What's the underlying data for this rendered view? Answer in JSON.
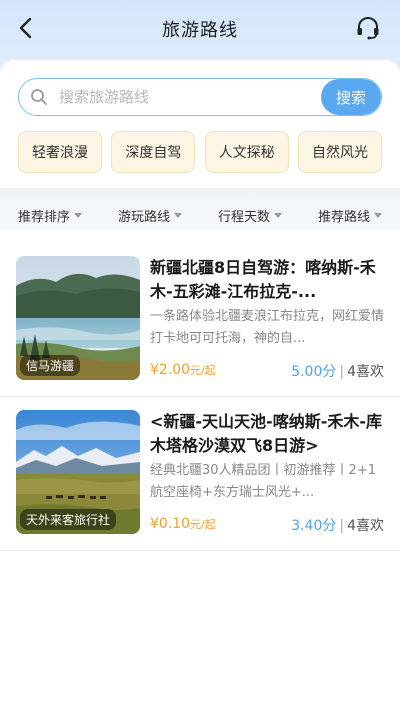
{
  "header": {
    "title": "旅游路线",
    "back_icon": "chevron-left-icon",
    "support_icon": "headset-icon"
  },
  "search": {
    "placeholder": "搜索旅游路线",
    "button_label": "搜索"
  },
  "categories": [
    "轻奢浪漫",
    "深度自驾",
    "人文探秘",
    "自然风光"
  ],
  "filters": [
    "推荐排序",
    "游玩路线",
    "行程天数",
    "推荐路线"
  ],
  "routes": [
    {
      "title": "新疆北疆8日自驾游：喀纳斯-禾木-五彩滩-江布拉克-...",
      "description": "一条路体验北疆麦浪江布拉克，网红爱情打卡地可可托海，神的自...",
      "price": "¥2.00",
      "price_unit": "元/起",
      "score": "5.00分",
      "likes": "4喜欢",
      "agency": "信马游疆"
    },
    {
      "title": "<新疆-天山天池-喀纳斯-禾木-库木塔格沙漠双飞8日游>",
      "description": "经典北疆30人精品团丨初游推荐丨2+1航空座椅+东方瑞士风光+...",
      "price": "¥0.10",
      "price_unit": "元/起",
      "score": "3.40分",
      "likes": "4喜欢",
      "agency": "天外来客旅行社"
    }
  ],
  "colors": {
    "accent": "#5aa9f0",
    "price": "#f0a030",
    "score": "#4aa3e8",
    "chip_bg": "#fdf5e4"
  }
}
